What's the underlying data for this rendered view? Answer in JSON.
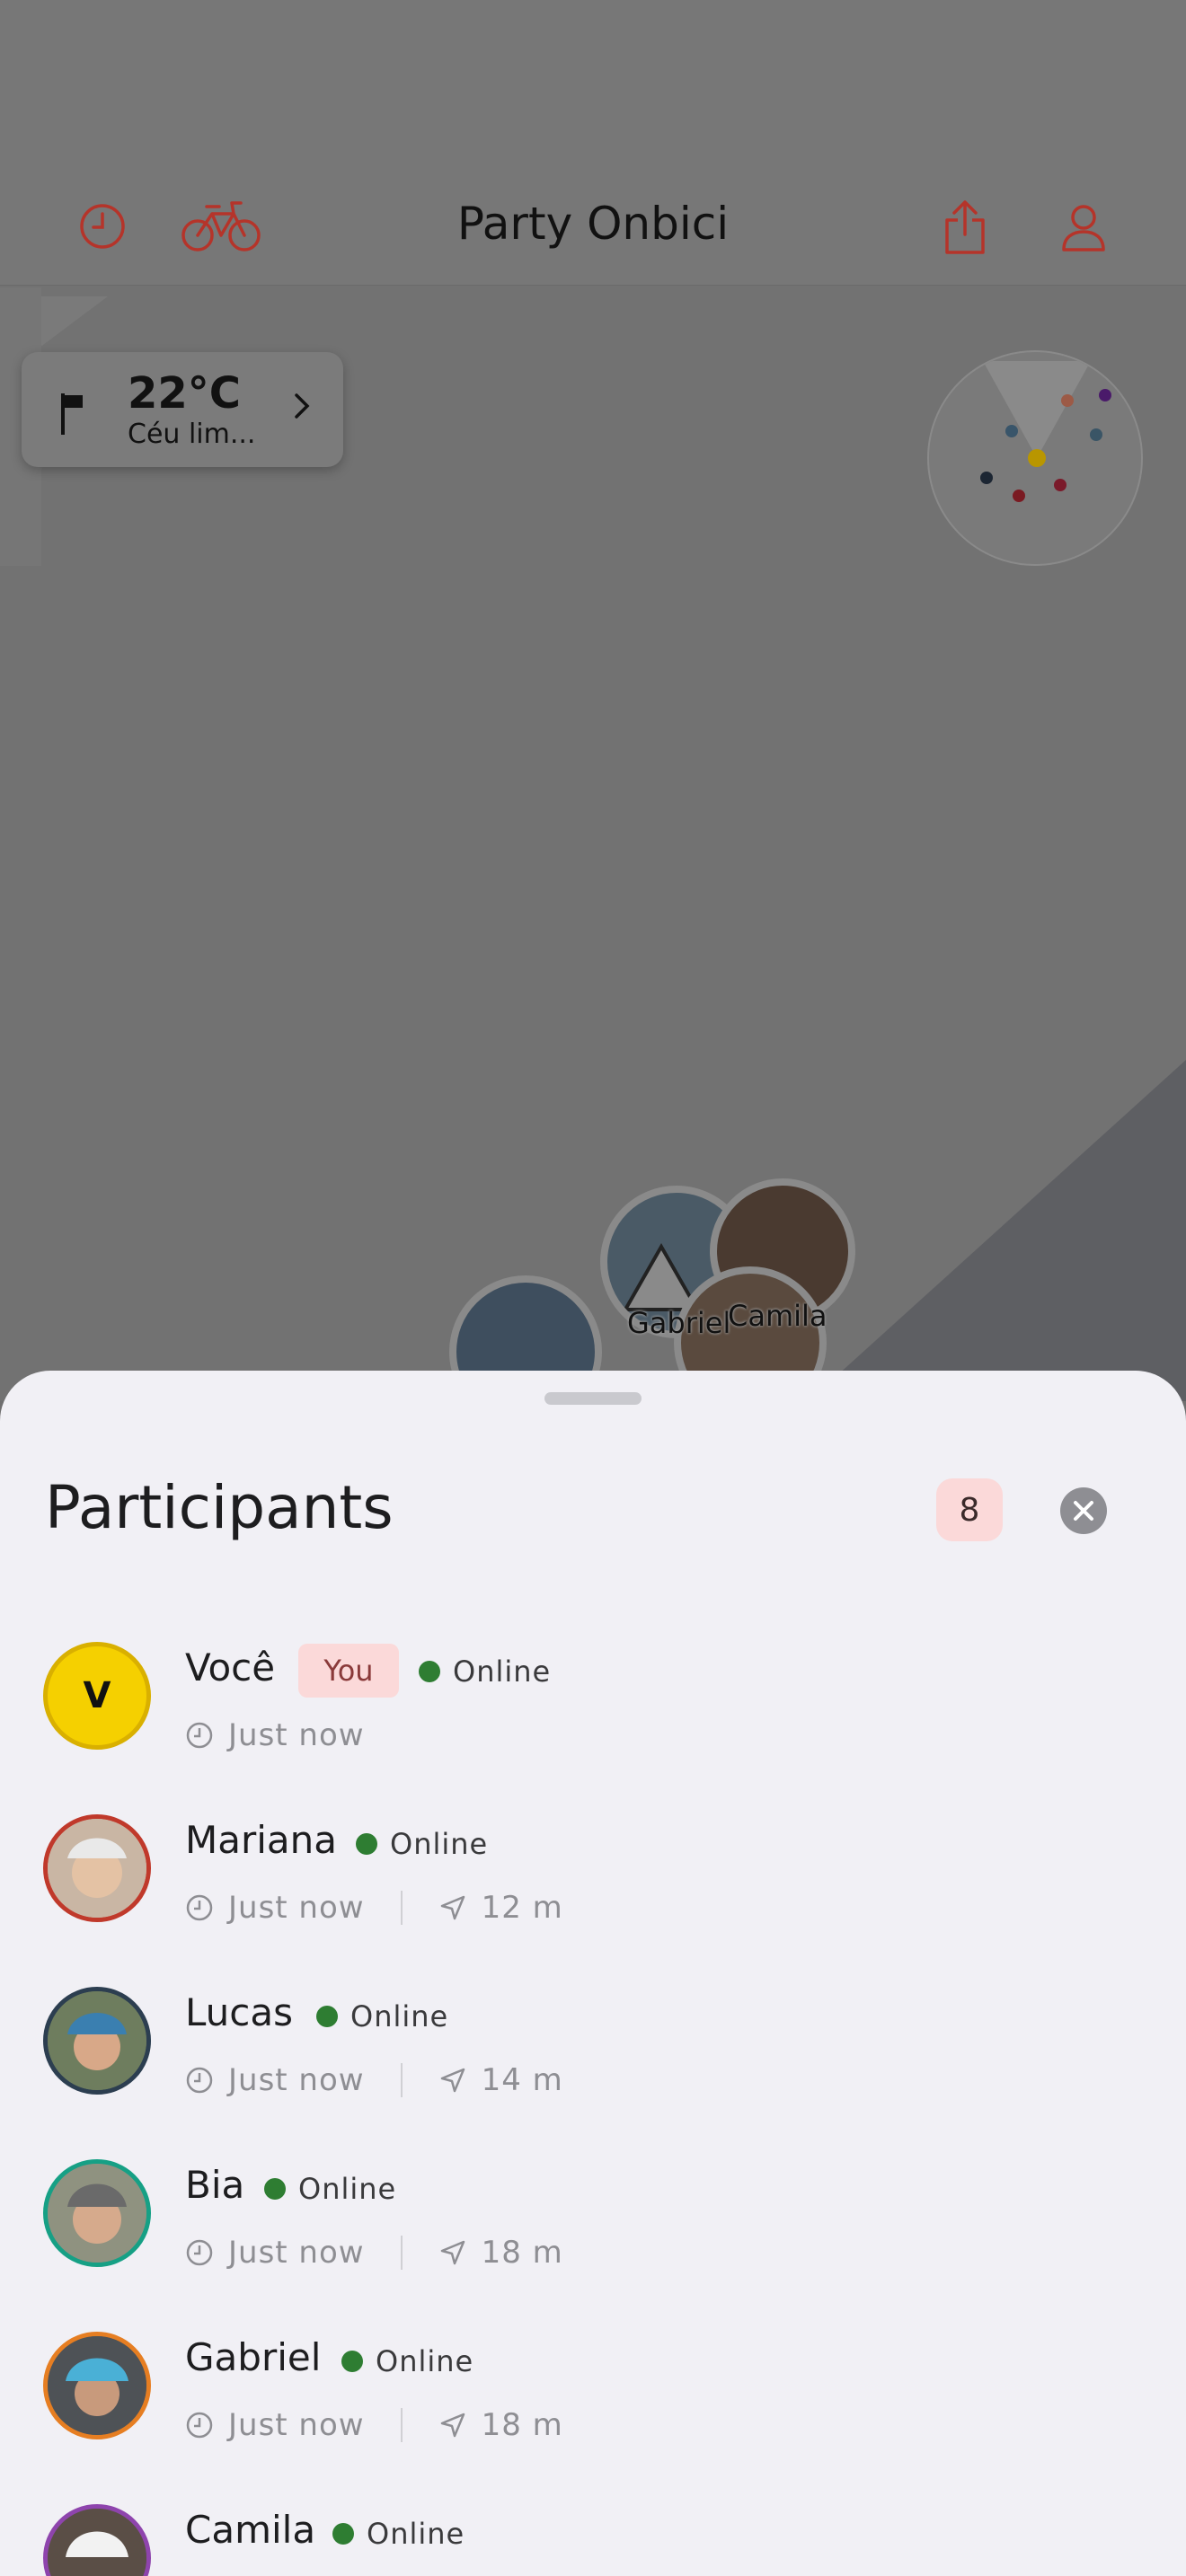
{
  "header": {
    "title": "Party Onbici",
    "accent_color": "#c0392b"
  },
  "weather": {
    "temperature": "22°C",
    "description": "Céu lim..."
  },
  "map": {
    "pins": [
      {
        "label": "Gabriel"
      },
      {
        "label": "Camila"
      }
    ]
  },
  "sheet": {
    "title": "Participants",
    "count": "8"
  },
  "participants": [
    {
      "name": "Você",
      "initial": "V",
      "badge": "You",
      "status": "Online",
      "time": "Just now",
      "distance": "",
      "ring": "#d9b000"
    },
    {
      "name": "Mariana",
      "initial": "",
      "status": "Online",
      "time": "Just now",
      "distance": "12 m",
      "ring": "#c0392b"
    },
    {
      "name": "Lucas",
      "initial": "",
      "status": "Online",
      "time": "Just now",
      "distance": "14 m",
      "ring": "#2c3e50"
    },
    {
      "name": "Bia",
      "initial": "",
      "status": "Online",
      "time": "Just now",
      "distance": "18 m",
      "ring": "#16a085"
    },
    {
      "name": "Gabriel",
      "initial": "",
      "status": "Online",
      "time": "Just now",
      "distance": "18 m",
      "ring": "#e67e22"
    },
    {
      "name": "Camila",
      "initial": "",
      "status": "Online",
      "time": "",
      "distance": "",
      "ring": "#8e44ad"
    }
  ]
}
